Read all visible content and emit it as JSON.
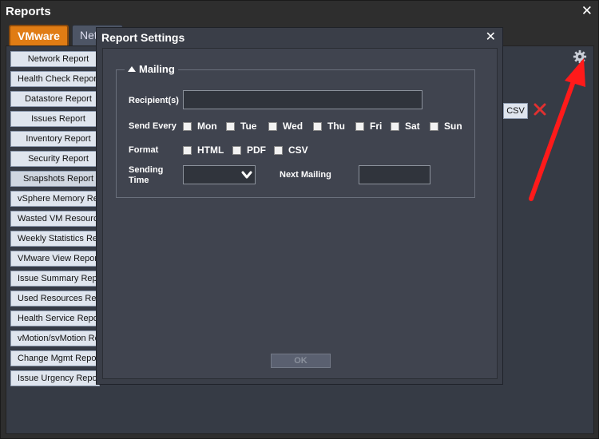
{
  "window": {
    "title": "Reports",
    "close_glyph": "✕"
  },
  "tabs": [
    {
      "label": "VMware"
    },
    {
      "label": "Net"
    }
  ],
  "reports": [
    "Network Report",
    "Health Check Report",
    "Datastore Report",
    "Issues Report",
    "Inventory Report",
    "Security Report",
    "Snapshots Report",
    "vSphere Memory Report",
    "Wasted VM Resources",
    "Weekly Statistics Report",
    "VMware View Report",
    "Issue Summary Report",
    "Used Resources Report",
    "Health Service Report",
    "vMotion/svMotion Report",
    "Change Mgmt Report",
    "Issue Urgency Report"
  ],
  "toolbar": {
    "csv_label": "CSV",
    "gear_icon": "gear-icon",
    "delete_icon": "red-x-icon"
  },
  "modal": {
    "title": "Report Settings",
    "close_glyph": "✕",
    "section_title": "Mailing",
    "recipients_label": "Recipient(s)",
    "recipients_value": "",
    "send_every_label": "Send Every",
    "days": [
      "Mon",
      "Tue",
      "Wed",
      "Thu",
      "Fri",
      "Sat",
      "Sun"
    ],
    "format_label": "Format",
    "formats": [
      "HTML",
      "PDF",
      "CSV"
    ],
    "sending_time_label_1": "Sending",
    "sending_time_label_2": "Time",
    "next_mailing_label": "Next Mailing",
    "next_mailing_value": "",
    "ok_label": "OK"
  },
  "colors": {
    "accent_tab": "#e07c14",
    "annotation_arrow": "#ff1a1a",
    "delete_x": "#e03030"
  }
}
